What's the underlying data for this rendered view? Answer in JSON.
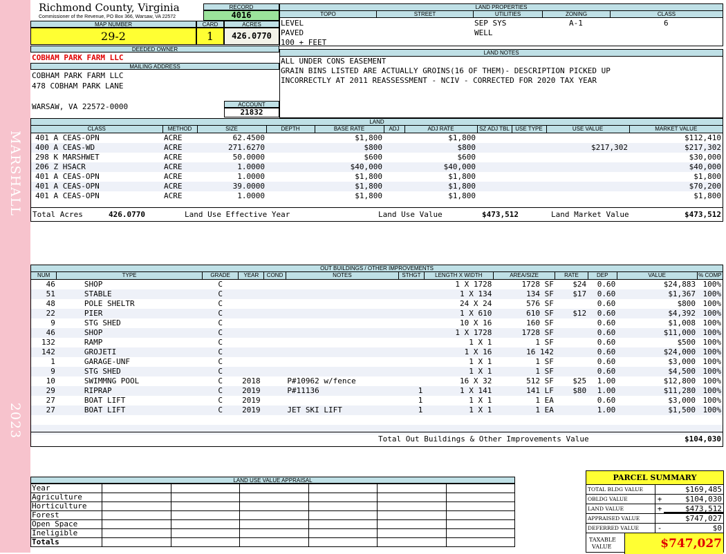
{
  "county": {
    "name": "Richmond County, Virginia",
    "address": "Commissioner of the Revenue, PO Box 366, Warsaw, VA 22572"
  },
  "sidebar": {
    "district": "MARSHALL",
    "year": "2023"
  },
  "record": {
    "label": "RECORD",
    "value": "4016"
  },
  "map": {
    "label": "MAP NUMBER",
    "value": "29-2"
  },
  "card": {
    "label": "CARD",
    "value": "1"
  },
  "acres": {
    "label": "ACRES",
    "value": "426.0770"
  },
  "land_properties": {
    "title": "LAND PROPERTIES",
    "headers": [
      "TOPO",
      "STREET",
      "UTILITIES",
      "ZONING",
      "CLASS"
    ],
    "topo": [
      "LEVEL",
      "PAVED",
      "100 + FEET"
    ],
    "utilities": [
      "SEP SYS",
      "WELL"
    ],
    "zoning": "A-1",
    "class": "6"
  },
  "owner": {
    "label": "DEEDED OWNER",
    "name": "COBHAM PARK FARM LLC"
  },
  "mailing": {
    "label": "MAILING ADDRESS",
    "lines": [
      "COBHAM PARK FARM LLC",
      "478 COBHAM PARK LANE",
      "",
      "WARSAW, VA 22572-0000"
    ]
  },
  "account": {
    "label": "ACCOUNT",
    "value": "21832"
  },
  "land_notes": {
    "title": "LAND NOTES",
    "lines": [
      "ALL UNDER CONS EASEMENT",
      "GRAIN BINS LISTED ARE ACTUALLY GROINS(16 OF THEM)- DESCRIPTION PICKED UP",
      "INCORRECTLY AT 2011 REASSESSMENT - NCIV - CORRECTED FOR 2020 TAX YEAR"
    ]
  },
  "land": {
    "title": "LAND",
    "headers": [
      "CLASS",
      "METHOD",
      "SIZE",
      "DEPTH",
      "BASE RATE",
      "ADJ",
      "ADJ RATE",
      "SZ ADJ TBL",
      "USE TYPE",
      "USE VALUE",
      "MARKET VALUE"
    ],
    "rows": [
      [
        "401 A CEAS-OPN",
        "ACRE",
        "62.4500",
        "",
        "$1,800",
        "",
        "$1,800",
        "",
        "",
        "",
        "$112,410"
      ],
      [
        "400 A CEAS-WD",
        "ACRE",
        "271.6270",
        "",
        "$800",
        "",
        "$800",
        "",
        "",
        "$217,302",
        "$217,302"
      ],
      [
        "298 K MARSHWET",
        "ACRE",
        "50.0000",
        "",
        "$600",
        "",
        "$600",
        "",
        "",
        "",
        "$30,000"
      ],
      [
        "206 Z HSACR",
        "ACRE",
        "1.0000",
        "",
        "$40,000",
        "",
        "$40,000",
        "",
        "",
        "",
        "$40,000"
      ],
      [
        "401 A CEAS-OPN",
        "ACRE",
        "1.0000",
        "",
        "$1,800",
        "",
        "$1,800",
        "",
        "",
        "",
        "$1,800"
      ],
      [
        "401 A CEAS-OPN",
        "ACRE",
        "39.0000",
        "",
        "$1,800",
        "",
        "$1,800",
        "",
        "",
        "",
        "$70,200"
      ],
      [
        "401 A CEAS-OPN",
        "ACRE",
        "1.0000",
        "",
        "$1,800",
        "",
        "$1,800",
        "",
        "",
        "",
        "$1,800"
      ]
    ],
    "totals": {
      "acres_label": "Total Acres",
      "acres": "426.0770",
      "eff_label": "Land Use Effective Year",
      "use_label": "Land Use Value",
      "use_value": "$473,512",
      "market_label": "Land Market Value",
      "market_value": "$473,512"
    }
  },
  "outbuildings": {
    "title": "OUT BUILDINGS / OTHER IMPROVEMENTS",
    "headers": [
      "NUM",
      "TYPE",
      "GRADE",
      "YEAR",
      "COND",
      "NOTES",
      "STHGT",
      "LENGTH X WIDTH",
      "AREA/SIZE",
      "RATE",
      "DEP",
      "VALUE",
      "% COMP"
    ],
    "rows": [
      [
        "46",
        "SHOP",
        "C",
        "",
        "",
        "",
        "",
        "1 X 1728",
        "1728 SF",
        "$24",
        "0.60",
        "$24,883",
        "100%"
      ],
      [
        "51",
        "STABLE",
        "C",
        "",
        "",
        "",
        "",
        "1 X 134",
        "134 SF",
        "$17",
        "0.60",
        "$1,367",
        "100%"
      ],
      [
        "48",
        "POLE SHELTR",
        "C",
        "",
        "",
        "",
        "",
        "24 X 24",
        "576 SF",
        "",
        "0.60",
        "$800",
        "100%"
      ],
      [
        "22",
        "PIER",
        "C",
        "",
        "",
        "",
        "",
        "1 X 610",
        "610 SF",
        "$12",
        "0.60",
        "$4,392",
        "100%"
      ],
      [
        "9",
        "STG SHED",
        "C",
        "",
        "",
        "",
        "",
        "10 X 16",
        "160 SF",
        "",
        "0.60",
        "$1,008",
        "100%"
      ],
      [
        "46",
        "SHOP",
        "C",
        "",
        "",
        "",
        "",
        "1 X 1728",
        "1728 SF",
        "",
        "0.60",
        "$11,000",
        "100%"
      ],
      [
        "132",
        "RAMP",
        "C",
        "",
        "",
        "",
        "",
        "1 X 1",
        "1 SF",
        "",
        "0.60",
        "$500",
        "100%"
      ],
      [
        "142",
        "GROJETI",
        "C",
        "",
        "",
        "",
        "",
        "1 X 16",
        "16 142",
        "",
        "0.60",
        "$24,000",
        "100%"
      ],
      [
        "1",
        "GARAGE-UNF",
        "C",
        "",
        "",
        "",
        "",
        "1 X 1",
        "1 SF",
        "",
        "0.60",
        "$3,000",
        "100%"
      ],
      [
        "9",
        "STG SHED",
        "C",
        "",
        "",
        "",
        "",
        "1 X 1",
        "1 SF",
        "",
        "0.60",
        "$4,500",
        "100%"
      ],
      [
        "10",
        "SWIMMNG POOL",
        "C",
        "2018",
        "",
        "P#10962 w/fence",
        "",
        "16 X 32",
        "512 SF",
        "$25",
        "1.00",
        "$12,800",
        "100%"
      ],
      [
        "29",
        "RIPRAP",
        "C",
        "2019",
        "",
        "P#11136",
        "1",
        "1 X 141",
        "141 LF",
        "$80",
        "1.00",
        "$11,280",
        "100%"
      ],
      [
        "27",
        "BOAT LIFT",
        "C",
        "2019",
        "",
        "",
        "1",
        "1 X 1",
        "1 EA",
        "",
        "0.60",
        "$3,000",
        "100%"
      ],
      [
        "27",
        "BOAT LIFT",
        "C",
        "2019",
        "",
        "JET SKI LIFT",
        "1",
        "1 X 1",
        "1 EA",
        "",
        "1.00",
        "$1,500",
        "100%"
      ]
    ],
    "total_label": "Total Out Buildings & Other Improvements Value",
    "total_value": "$104,030"
  },
  "luva": {
    "title": "LAND USE VALUE APPRAISAL",
    "rows": [
      "Year",
      "Agriculture",
      "Horticulture",
      "Forest",
      "Open Space",
      "Ineligible",
      "Totals"
    ]
  },
  "summary": {
    "title": "PARCEL SUMMARY",
    "rows": [
      {
        "label": "TOTAL BLDG VALUE",
        "sign": "",
        "value": "$169,485"
      },
      {
        "label": "OBLDG VALUE",
        "sign": "+",
        "value": "$104,030"
      },
      {
        "label": "LAND VALUE",
        "sign": "+",
        "value": "$473,512"
      },
      {
        "label": "APPRAISED VALUE",
        "sign": "",
        "value": "$747,027"
      },
      {
        "label": "DEFERRED VALUE",
        "sign": "-",
        "value": "$0"
      }
    ],
    "taxable_label_1": "TAXABLE",
    "taxable_label_2": "VALUE",
    "taxable_value": "$747,027"
  }
}
